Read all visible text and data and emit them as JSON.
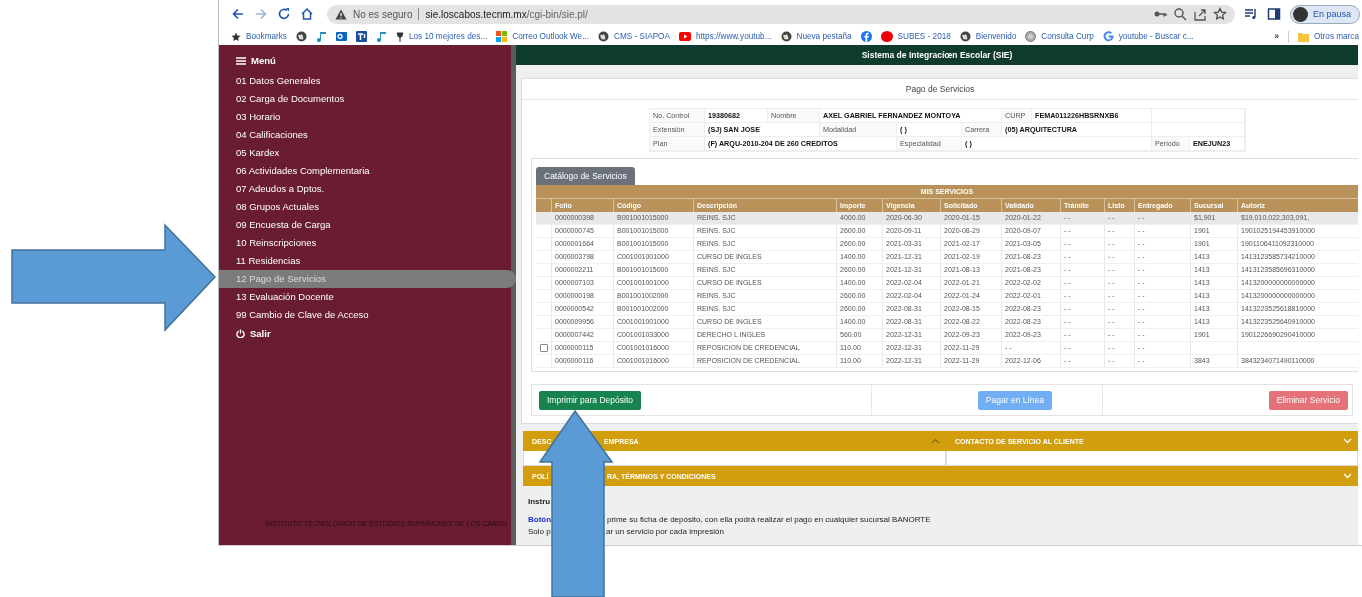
{
  "browser": {
    "address": {
      "security": "No es seguro",
      "host": "sie.loscabos.tecnm.mx",
      "path": "/cgi-bin/sie.pl/"
    },
    "profile": "En pausa",
    "bookmarks": [
      "Bookmarks",
      "Los 10 mejores des...",
      "Correo Outlook We...",
      "CMS - SIAPOA",
      "https://www.youtub...",
      "Nueva pestaña",
      "SUBES - 2018",
      "Bienvenido",
      "Consulta Curp",
      "youtube - Buscar c..."
    ],
    "overflow": "»",
    "other_bookmarks": "Otros marca"
  },
  "sidebar": {
    "menu": "Menú",
    "items": [
      {
        "label": "01 Datos Generales",
        "selected": false
      },
      {
        "label": "02 Carga de Documentos",
        "selected": false
      },
      {
        "label": "03 Horario",
        "selected": false
      },
      {
        "label": "04 Calificaciones",
        "selected": false
      },
      {
        "label": "05 Kardex",
        "selected": false
      },
      {
        "label": "06 Actividades Complementaria",
        "selected": false
      },
      {
        "label": "07 Adeudos a Dptos.",
        "selected": false
      },
      {
        "label": "08 Grupos Actuales",
        "selected": false
      },
      {
        "label": "09 Encuesta de Carga",
        "selected": false
      },
      {
        "label": "10 Reinscripciones",
        "selected": false
      },
      {
        "label": "11 Residencias",
        "selected": false
      },
      {
        "label": "12 Pago de Servicios",
        "selected": true
      },
      {
        "label": "13 Evaluación Docente",
        "selected": false
      },
      {
        "label": "99 Cambio de Clave de Acceso",
        "selected": false
      }
    ],
    "exit": "Salir",
    "footer": "INSTITUTO TECNOLÓGICO DE ESTUDIOS SUPERIORES DE LOS CABOS"
  },
  "header": {
    "title": "Sistema de Integracíœn Escolar (SIE)"
  },
  "page": {
    "title": "Pago de Servicios",
    "student": [
      [
        {
          "kind": "label",
          "text": "No. Control"
        },
        {
          "kind": "value",
          "text": "19380682"
        },
        {
          "kind": "label",
          "text": "Nombre"
        },
        {
          "kind": "value",
          "text": "AXEL GABRIEL FERNANDEZ MONTOYA"
        },
        {
          "kind": "label",
          "text": "CURP"
        },
        {
          "kind": "value",
          "text": "FEMA011226HBSRNXB6"
        },
        {
          "kind": "empty"
        }
      ],
      [
        {
          "kind": "label",
          "text": "Extensión"
        },
        {
          "kind": "value",
          "text": "(SJ) SAN JOSE"
        },
        {
          "kind": "label",
          "text": "Modalidad"
        },
        {
          "kind": "value",
          "text": "( )"
        },
        {
          "kind": "label",
          "text": "Carrera"
        },
        {
          "kind": "value",
          "text": "(05) ARQUITECTURA"
        },
        {
          "kind": "empty"
        }
      ],
      [
        {
          "kind": "label",
          "text": "Plan"
        },
        {
          "kind": "value",
          "text": "(F) ARQU-2010-204 DE 260 CREDITOS"
        },
        {
          "kind": "label",
          "text": "Especialidad"
        },
        {
          "kind": "value",
          "text": "( )"
        },
        {
          "kind": "label",
          "text": "Periodo"
        },
        {
          "kind": "value",
          "text": "ENEJUN23"
        }
      ]
    ],
    "catalog_button": "Catálogo de Servicios",
    "table": {
      "title": "MIS SERVICIOS",
      "columns": [
        "Folio",
        "Código",
        "Descripción",
        "Importe",
        "Vigencia",
        "Solicitado",
        "Validado",
        "Trámite",
        "Listo",
        "Entregado",
        "Sucursal",
        "Autoriz"
      ],
      "rows": [
        {
          "selected": true,
          "cells": [
            "0000000398",
            "B001001015000",
            "REINS. SJC",
            "4000.00",
            "2020-06-30",
            "2020-01-15",
            "2020-01-22",
            "- -",
            "- -",
            "- -",
            "$1,901",
            "$19,010,022,303,091,"
          ]
        },
        {
          "selected": false,
          "cells": [
            "0000000745",
            "B001001015000",
            "REINS. SJC",
            "2600.00",
            "2020-09-11",
            "2020-08-29",
            "2020-09-07",
            "- -",
            "- -",
            "- -",
            "1901",
            "1901025194453910000"
          ]
        },
        {
          "selected": false,
          "cells": [
            "0000001664",
            "B001001015000",
            "REINS. SJC",
            "2600.00",
            "2021-03-31",
            "2021-02-17",
            "2021-03-05",
            "- -",
            "- -",
            "- -",
            "1901",
            "1901106411092310000"
          ]
        },
        {
          "selected": false,
          "cells": [
            "0000003798",
            "C001001001000",
            "CURSO DE INGLES",
            "1400.00",
            "2021-12-31",
            "2021-02-19",
            "2021-08-23",
            "- -",
            "- -",
            "- -",
            "1413",
            "1413123585734210000"
          ]
        },
        {
          "selected": false,
          "cells": [
            "0000002211",
            "B001001015000",
            "REINS. SJC",
            "2600.00",
            "2021-12-31",
            "2021-08-13",
            "2021-08-23",
            "- -",
            "- -",
            "- -",
            "1413",
            "1413123585696310000"
          ]
        },
        {
          "selected": false,
          "cells": [
            "0000007103",
            "C001001001000",
            "CURSO DE INGLES",
            "1400.00",
            "2022-02-04",
            "2022-01-21",
            "2022-02-02",
            "- -",
            "- -",
            "- -",
            "1413",
            "1413200000000000000"
          ]
        },
        {
          "selected": false,
          "cells": [
            "0000000198",
            "B001001002000",
            "REINS. SJC",
            "2600.00",
            "2022-02-04",
            "2022-01-24",
            "2022-02-01",
            "- -",
            "- -",
            "- -",
            "1413",
            "1413200000000000000"
          ]
        },
        {
          "selected": false,
          "cells": [
            "0000000542",
            "B001001002000",
            "REINS. SJC",
            "2600.00",
            "2022-08-31",
            "2022-08-15",
            "2022-08-23",
            "- -",
            "- -",
            "- -",
            "1413",
            "1413223525618810000"
          ]
        },
        {
          "selected": false,
          "cells": [
            "0000009956",
            "C001001001000",
            "CURSO DE INGLES",
            "1400.00",
            "2022-08-31",
            "2022-08-22",
            "2022-08-23",
            "- -",
            "- -",
            "- -",
            "1413",
            "1413223525640910000"
          ]
        },
        {
          "selected": false,
          "cells": [
            "0000007442",
            "C001001033000",
            "DERECHO L INGLES",
            "560.00",
            "2022-12-31",
            "2022-09-23",
            "2022-09-23",
            "- -",
            "- -",
            "- -",
            "1901",
            "1901226690290410000"
          ]
        },
        {
          "selected": false,
          "checkbox": {
            "checked": false
          },
          "cells": [
            "0000000115",
            "C001001016000",
            "REPOSICION DE CREDENCIAL",
            "110.00",
            "2022-12-31",
            "2022-11-29",
            "- -",
            "- -",
            "- -",
            "- -"
          ]
        },
        {
          "selected": false,
          "cells": [
            "0000000116",
            "C001001016000",
            "REPOSICION DE CREDENCIAL",
            "110.00",
            "2022-12-31",
            "2022-11-29",
            "2022-12-06",
            "- -",
            "- -",
            "- -",
            "3843",
            "3843234071490110000"
          ]
        }
      ]
    },
    "buttons": [
      {
        "label": "Imprimir para Depósito",
        "kind": "success",
        "disabled": false
      },
      {
        "label": "Pagar en Línea",
        "kind": "primary",
        "disabled": true
      },
      {
        "label": "Eliminar Servicio",
        "kind": "danger",
        "disabled": true
      }
    ]
  },
  "sections": [
    {
      "title": [
        "DESC",
        "EMPRESA"
      ],
      "expanded": true
    },
    {
      "title": [
        "CONTACTO DE SERVICIO AL CLIENTE"
      ],
      "expanded": false
    },
    {
      "title": [
        "POLÍ",
        "RA, TÉRMINOS Y CONDICIONES"
      ],
      "expanded": false
    }
  ],
  "instructions": [
    {
      "text": [
        "Instru"
      ],
      "kind": "heading"
    },
    {
      "text": [
        "Botón",
        "prime su ficha de depósito, con ella podrá realizar el pago en cualquier sucursal BANORTE"
      ],
      "kind": "lead"
    },
    {
      "text": [
        "Solo p",
        "ar un servicio por cada impresión"
      ],
      "kind": "plain"
    }
  ]
}
